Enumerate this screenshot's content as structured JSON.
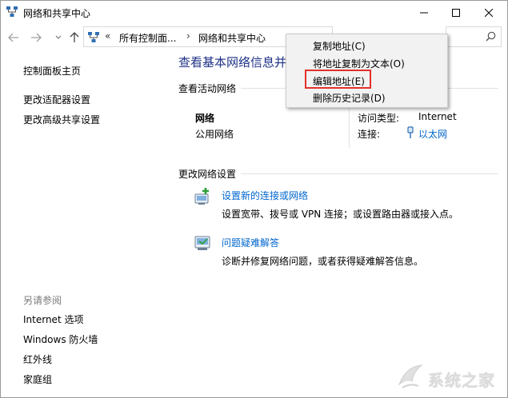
{
  "window": {
    "title": "网络和共享中心"
  },
  "navigation": {
    "breadcrumb_prefix": "«",
    "crumbs": [
      "所有控制面...",
      "网络和共享中心"
    ],
    "crumb_separator": "›"
  },
  "sidebar": {
    "items": [
      {
        "label": "控制面板主页"
      },
      {
        "label": "更改适配器设置"
      },
      {
        "label": "更改高级共享设置"
      }
    ],
    "see_also_heading": "另请参阅",
    "see_also": [
      {
        "label": "Internet 选项"
      },
      {
        "label": "Windows 防火墙"
      },
      {
        "label": "红外线"
      },
      {
        "label": "家庭组"
      }
    ]
  },
  "main": {
    "title": "查看基本网络信息并",
    "active_networks_heading": "查看活动网络",
    "network": {
      "name": "网络",
      "type": "公用网络",
      "access_type_label": "访问类型:",
      "access_type_value": "Internet",
      "connection_label": "连接:",
      "connection_value": "以太网"
    },
    "change_settings_heading": "更改网络设置",
    "tasks": [
      {
        "link": "设置新的连接或网络",
        "description": "设置宽带、拨号或 VPN 连接；或设置路由器或接入点。"
      },
      {
        "link": "问题疑难解答",
        "description": "诊断并修复网络问题，或者获得疑难解答信息。"
      }
    ]
  },
  "context_menu": {
    "items": [
      {
        "label": "复制地址(C)"
      },
      {
        "label": "将地址复制为文本(O)"
      },
      {
        "label": "编辑地址(E)"
      },
      {
        "label": "删除历史记录(D)"
      }
    ],
    "highlighted_index": 2,
    "highlight_color": "#e3312a"
  },
  "watermark": {
    "text": "系统之家"
  },
  "colors": {
    "link": "#0066cc",
    "title_blue": "#1e3287",
    "muted": "#7a7a7a"
  }
}
